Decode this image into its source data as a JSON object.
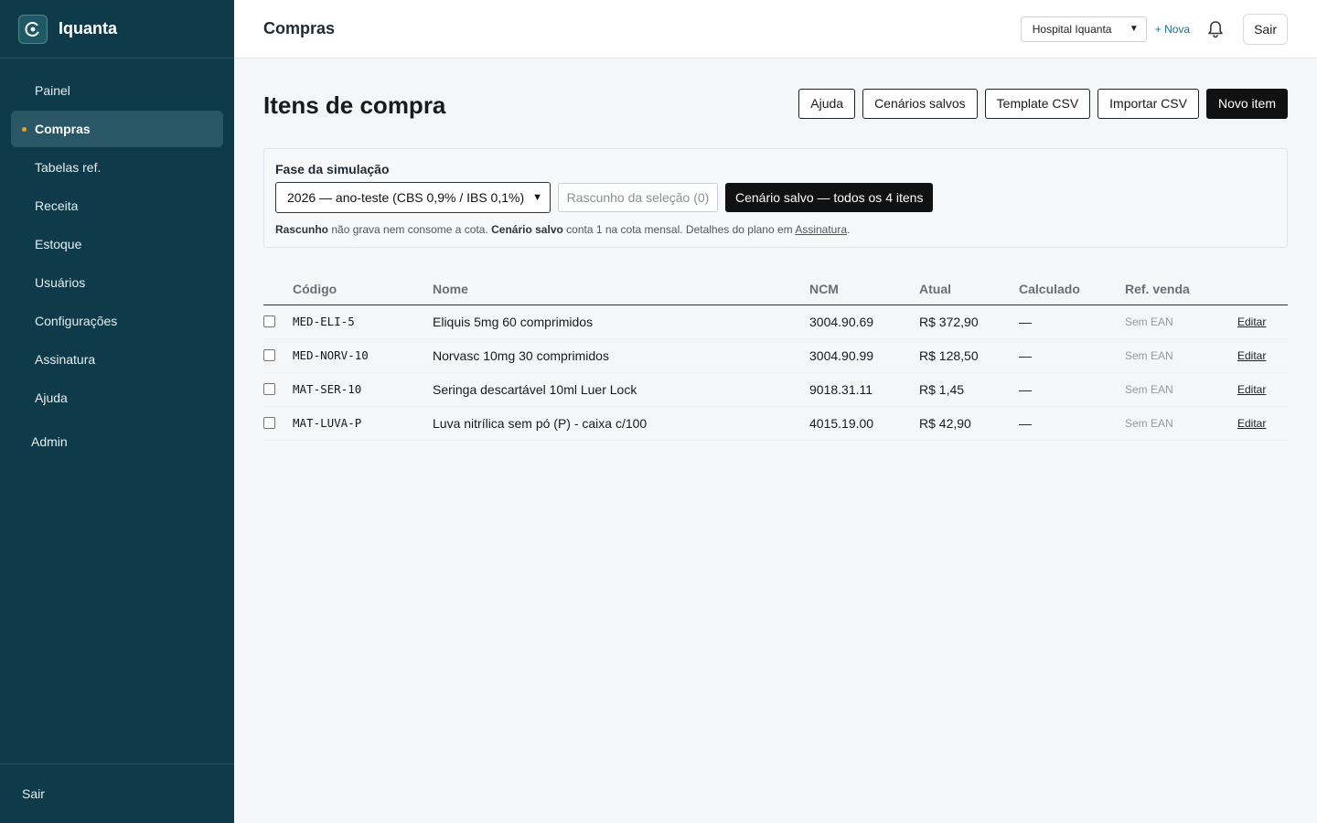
{
  "app": {
    "name": "Iquanta",
    "logo_icon": "iquanta-logo-icon"
  },
  "sidebar": {
    "items": [
      {
        "label": "Painel",
        "active": false
      },
      {
        "label": "Compras",
        "active": true
      },
      {
        "label": "Tabelas ref.",
        "active": false
      },
      {
        "label": "Receita",
        "active": false
      },
      {
        "label": "Estoque",
        "active": false
      },
      {
        "label": "Usuários",
        "active": false
      },
      {
        "label": "Configurações",
        "active": false
      },
      {
        "label": "Assinatura",
        "active": false
      },
      {
        "label": "Ajuda",
        "active": false
      }
    ],
    "admin_label": "Admin",
    "footer_logout": "Sair",
    "active_indicator_color": "#f0a020"
  },
  "topbar": {
    "title": "Compras",
    "org_select_value": "Hospital Iquanta",
    "new_link": "+ Nova",
    "bell_icon": "bell-icon",
    "logout_label": "Sair"
  },
  "page": {
    "heading": "Itens de compra",
    "actions": {
      "help": "Ajuda",
      "saved_scenarios": "Cenários salvos",
      "template_csv": "Template CSV",
      "import_csv": "Importar CSV",
      "new_item": "Novo item"
    }
  },
  "simulation": {
    "label": "Fase da simulação",
    "phase_value": "2026 — ano-teste (CBS 0,9% / IBS 0,1%)",
    "draft_button": "Rascunho da seleção (0)",
    "saved_button": "Cenário salvo — todos os 4 itens",
    "note": {
      "rascunho": "Rascunho",
      "text1": " não grava nem consome a cota. ",
      "cenario": "Cenário salvo",
      "text2": " conta 1 na cota mensal. Detalhes do plano em ",
      "link": "Assinatura",
      "end": "."
    }
  },
  "table": {
    "columns": {
      "code": "Código",
      "name": "Nome",
      "ncm": "NCM",
      "current": "Atual",
      "calculated": "Calculado",
      "ref_sale": "Ref. venda"
    },
    "rows": [
      {
        "code": "MED-ELI-5",
        "name": "Eliquis 5mg 60 comprimidos",
        "ncm": "3004.90.69",
        "current": "R$ 372,90",
        "calculated": "—",
        "ref_sale": "Sem EAN",
        "action": "Editar",
        "checked": false
      },
      {
        "code": "MED-NORV-10",
        "name": "Norvasc 10mg 30 comprimidos",
        "ncm": "3004.90.99",
        "current": "R$ 128,50",
        "calculated": "—",
        "ref_sale": "Sem EAN",
        "action": "Editar",
        "checked": false
      },
      {
        "code": "MAT-SER-10",
        "name": "Seringa descartável 10ml Luer Lock",
        "ncm": "9018.31.11",
        "current": "R$ 1,45",
        "calculated": "—",
        "ref_sale": "Sem EAN",
        "action": "Editar",
        "checked": false
      },
      {
        "code": "MAT-LUVA-P",
        "name": "Luva nitrílica sem pó (P) - caixa c/100",
        "ncm": "4015.19.00",
        "current": "R$ 42,90",
        "calculated": "—",
        "ref_sale": "Sem EAN",
        "action": "Editar",
        "checked": false
      }
    ]
  }
}
